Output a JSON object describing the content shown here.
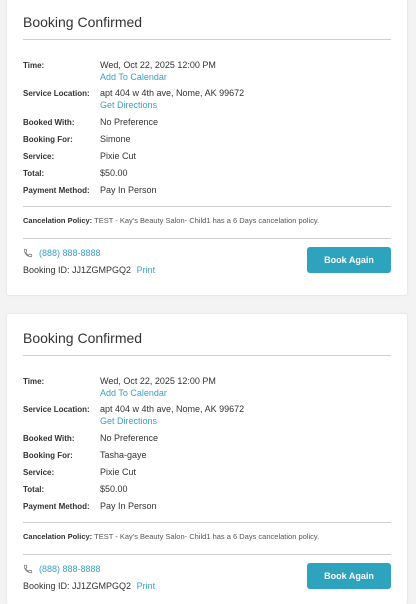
{
  "bookings": [
    {
      "title": "Booking Confirmed",
      "labels": {
        "time": "Time:",
        "location": "Service Location:",
        "with": "Booked With:",
        "for": "Booking For:",
        "service": "Service:",
        "total": "Total:",
        "payment": "Payment Method:",
        "policy": "Cancelation Policy:"
      },
      "time": "Wed, Oct 22, 2025 12:00 PM",
      "add_to_calendar": "Add To Calendar",
      "location": "apt 404 w 4th ave, Nome, AK 99672",
      "get_directions": "Get Directions",
      "booked_with": "No Preference",
      "booking_for": "Simone",
      "service": "Pixie Cut",
      "total": "$50.00",
      "payment_method": "Pay In Person",
      "policy_text": "TEST - Kay's Beauty Salon- Child1 has a 6 Days cancelation policy.",
      "phone": "(888) 888-8888",
      "booking_id_label": "Booking ID:",
      "booking_id": "JJ1ZGMPGQ2",
      "print": "Print",
      "book_again": "Book Again"
    },
    {
      "title": "Booking Confirmed",
      "labels": {
        "time": "Time:",
        "location": "Service Location:",
        "with": "Booked With:",
        "for": "Booking For:",
        "service": "Service:",
        "total": "Total:",
        "payment": "Payment Method:",
        "policy": "Cancelation Policy:"
      },
      "time": "Wed, Oct 22, 2025 12:00 PM",
      "add_to_calendar": "Add To Calendar",
      "location": "apt 404 w 4th ave, Nome, AK 99672",
      "get_directions": "Get Directions",
      "booked_with": "No Preference",
      "booking_for": "Tasha-gaye",
      "service": "Pixie Cut",
      "total": "$50.00",
      "payment_method": "Pay In Person",
      "policy_text": "TEST - Kay's Beauty Salon- Child1 has a 6 Days cancelation policy.",
      "phone": "(888) 888-8888",
      "booking_id_label": "Booking ID:",
      "booking_id": "JJ1ZGMPGQ2",
      "print": "Print",
      "book_again": "Book Again"
    }
  ],
  "colors": {
    "accent": "#2ea3bd",
    "link": "#3a9fc4",
    "background": "#f3f3f3"
  }
}
